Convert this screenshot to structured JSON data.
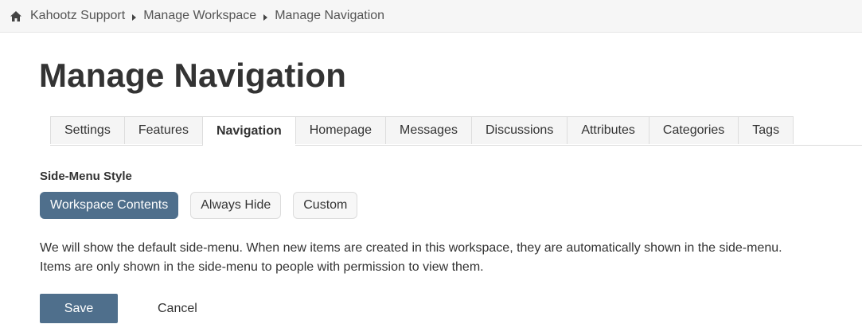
{
  "breadcrumb": {
    "home_icon": "home-icon",
    "items": [
      "Kahootz Support",
      "Manage Workspace",
      "Manage Navigation"
    ]
  },
  "page": {
    "title": "Manage Navigation"
  },
  "tabs": [
    {
      "label": "Settings",
      "active": false
    },
    {
      "label": "Features",
      "active": false
    },
    {
      "label": "Navigation",
      "active": true
    },
    {
      "label": "Homepage",
      "active": false
    },
    {
      "label": "Messages",
      "active": false
    },
    {
      "label": "Discussions",
      "active": false
    },
    {
      "label": "Attributes",
      "active": false
    },
    {
      "label": "Categories",
      "active": false
    },
    {
      "label": "Tags",
      "active": false
    }
  ],
  "side_menu": {
    "label": "Side-Menu Style",
    "options": [
      {
        "label": "Workspace Contents",
        "selected": true
      },
      {
        "label": "Always Hide",
        "selected": false
      },
      {
        "label": "Custom",
        "selected": false
      }
    ],
    "description_line1": "We will show the default side-menu. When new items are created in this workspace, they are automatically shown in the side-menu.",
    "description_line2": "Items are only shown in the side-menu to people with permission to view them."
  },
  "actions": {
    "save_label": "Save",
    "cancel_label": "Cancel"
  },
  "colors": {
    "accent": "#4f6f8c",
    "breadcrumb_bg": "#f6f6f6",
    "tab_bg": "#f5f5f5"
  }
}
